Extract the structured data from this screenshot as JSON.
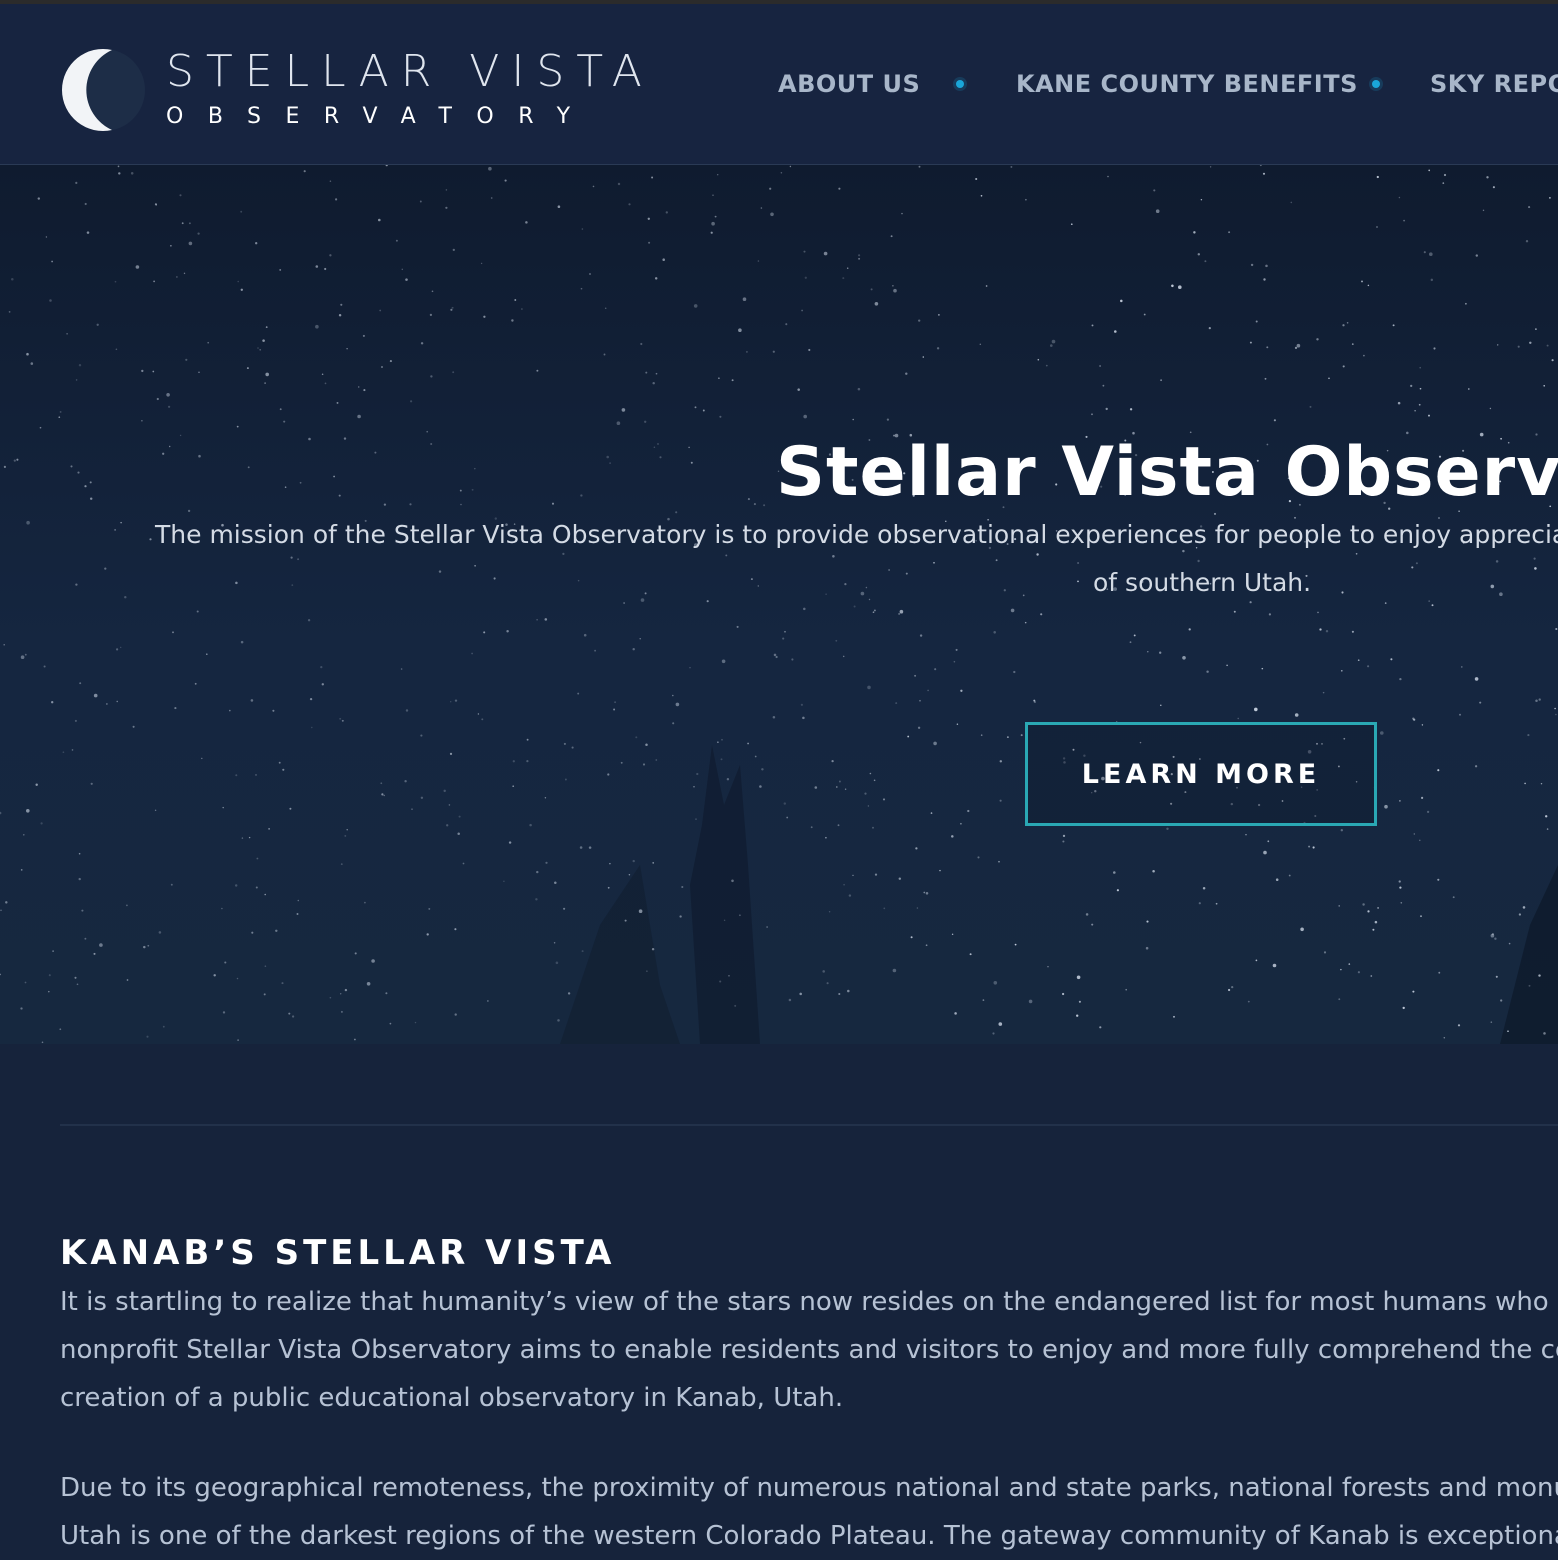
{
  "header": {
    "logo_title": "STELLAR VISTA",
    "logo_subtitle": "OBSERVATORY",
    "logo_icon": "crescent-moon-icon",
    "nav": [
      {
        "label": "ABOUT US"
      },
      {
        "label": "KANE COUNTY BENEFITS"
      },
      {
        "label": "SKY REPOR"
      }
    ],
    "nav_dot_color": "#1aa6d9"
  },
  "hero": {
    "title": "Stellar Vista Observato",
    "mission_line1": "The mission of the Stellar Vista Observatory is to provide observational experiences for people to enjoy appreciate a",
    "mission_line2": "of southern Utah.",
    "button_label": "LEARN MORE",
    "button_border_color": "#2aa8b4"
  },
  "main": {
    "section_title": "KANAB’S STELLAR VISTA",
    "paragraph1": [
      "It is startling to realize that humanity’s view of the stars now resides on the endangered list for most humans who c",
      "nonprofit Stellar Vista Observatory aims to enable residents and visitors to enjoy and more fully comprehend the ce",
      "creation of a public educational observatory in Kanab, Utah."
    ],
    "paragraph2": [
      "Due to its geographical remoteness, the proximity of numerous national and state parks, national forests and monu",
      "Utah is one of the darkest regions of the western Colorado Plateau. The gateway community of Kanab is exceptiona"
    ]
  },
  "colors": {
    "background": "#16233b",
    "header_bg": "#172440",
    "accent": "#2aa8b4"
  }
}
